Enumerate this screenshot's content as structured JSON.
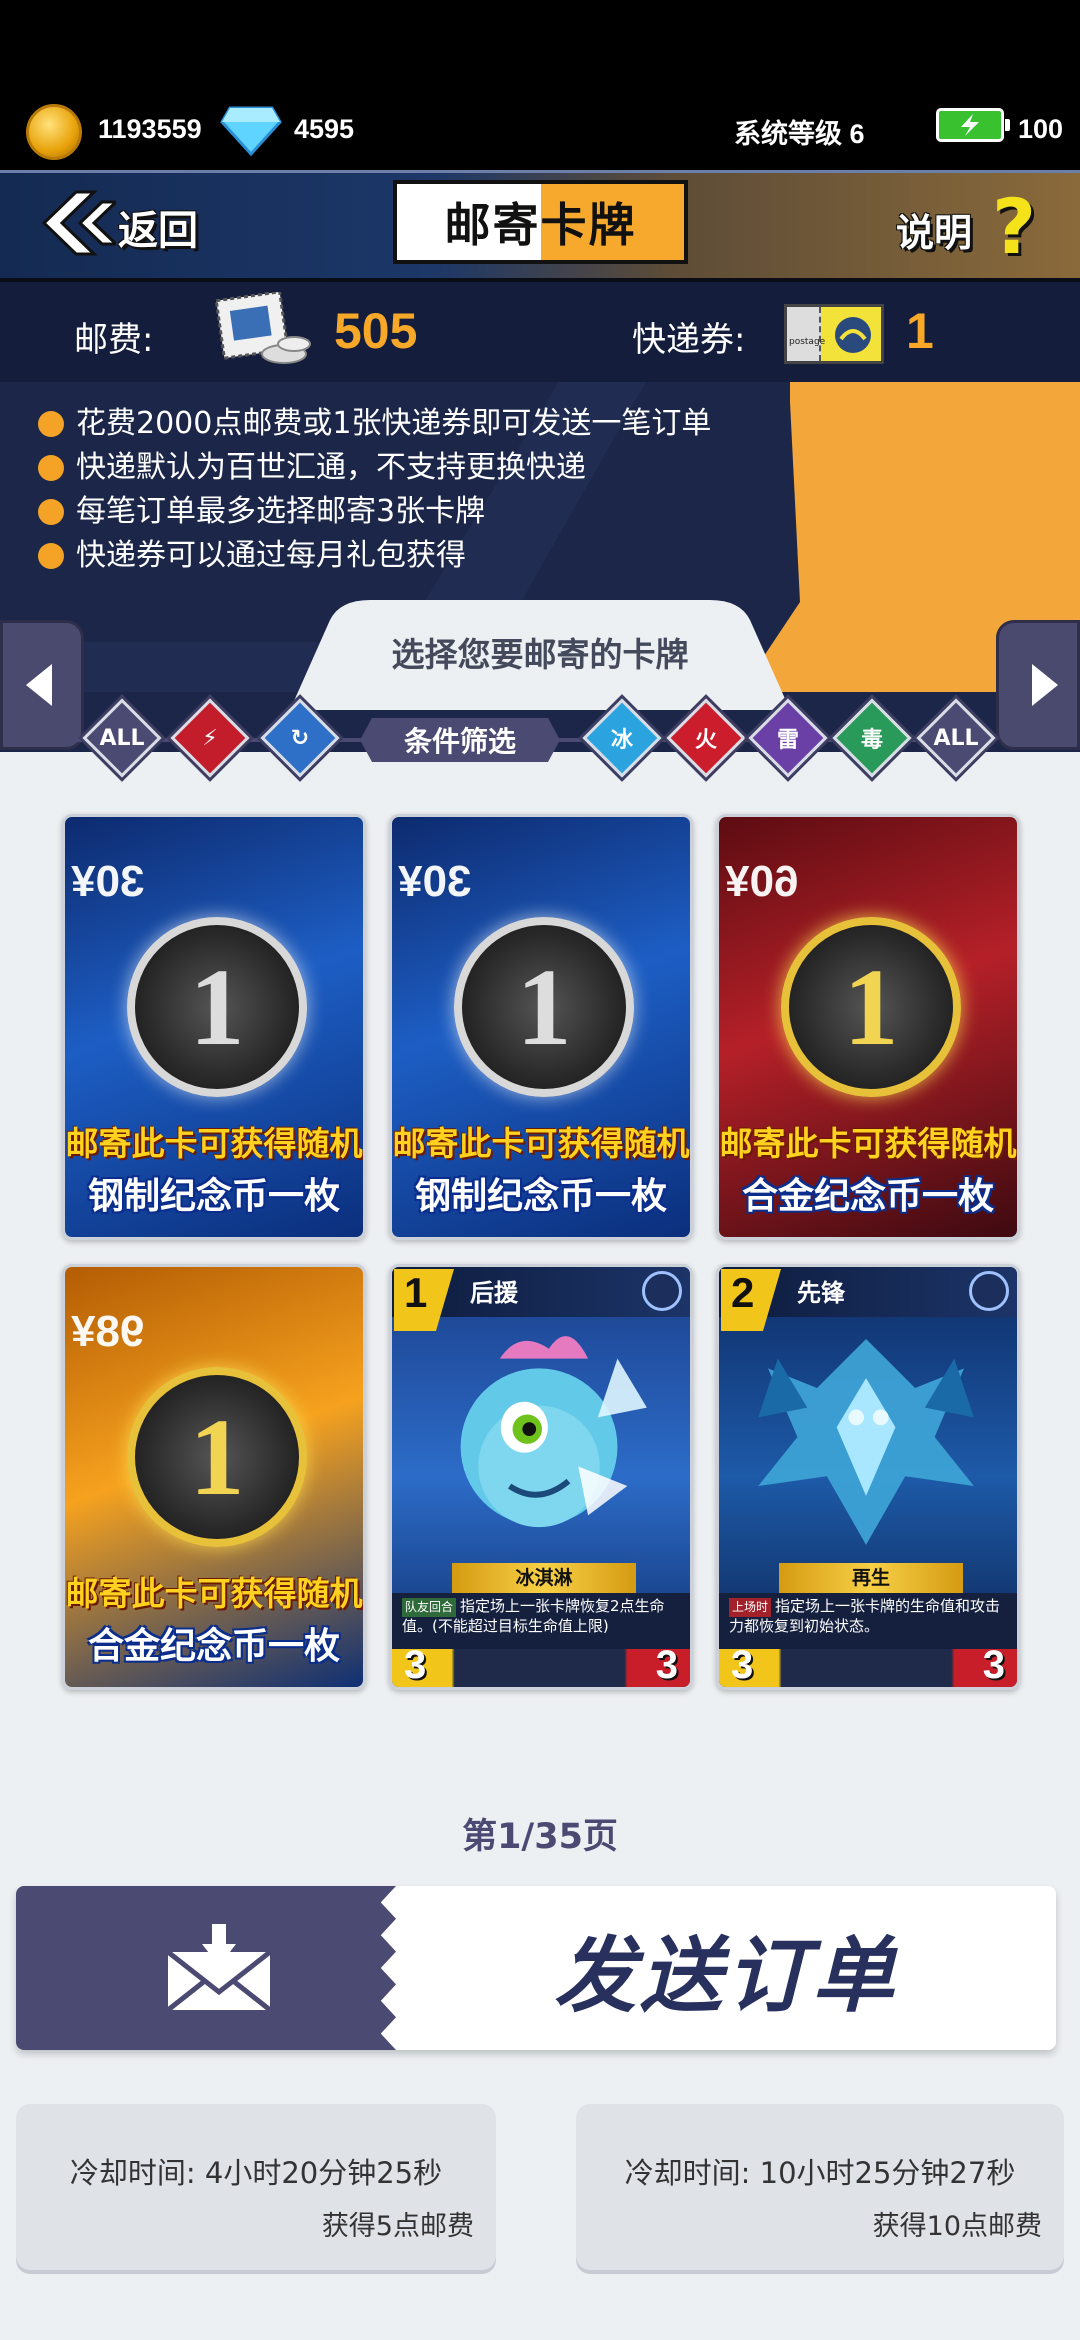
{
  "status_bar": {
    "gold": "1193559",
    "diamond": "4595",
    "system_level": "系统等级 6",
    "energy": "100"
  },
  "header": {
    "back_label": "返回",
    "title_left": "邮寄",
    "title_right": "卡牌",
    "help_label": "说明"
  },
  "info": {
    "postage_label": "邮费:",
    "postage_value": "505",
    "voucher_label": "快递券:",
    "voucher_value": "1",
    "voucher_icon_text": "postage",
    "rules": [
      "花费2000点邮费或1张快递券即可发送一笔订单",
      "快递默认为百世汇通，不支持更换快递",
      "每笔订单最多选择邮寄3张卡牌",
      "快递券可以通过每月礼包获得"
    ]
  },
  "select": {
    "title": "选择您要邮寄的卡牌",
    "filter_label": "条件筛选",
    "filters_left": [
      "ALL",
      "",
      ""
    ],
    "filters_right": [
      "冰",
      "火",
      "雷",
      "毒",
      "ALL"
    ]
  },
  "cards": [
    {
      "kind": "pack",
      "price": "30¥",
      "line1": "邮寄此卡可获得随机",
      "line2": "钢制纪念币一枚"
    },
    {
      "kind": "pack",
      "price": "30¥",
      "line1": "邮寄此卡可获得随机",
      "line2": "钢制纪念币一枚"
    },
    {
      "kind": "pack",
      "price": "60¥",
      "line1": "邮寄此卡可获得随机",
      "line2": "合金纪念币一枚"
    },
    {
      "kind": "pack",
      "price": "98¥",
      "line1": "邮寄此卡可获得随机",
      "line2": "合金纪念币一枚"
    },
    {
      "kind": "monster",
      "cost": "1",
      "role": "后援",
      "name": "冰淇淋",
      "tag": "队友回合",
      "desc": "指定场上一张卡牌恢复2点生命值。(不能超过目标生命值上限)",
      "atk": "3",
      "hp": "3"
    },
    {
      "kind": "monster",
      "cost": "2",
      "role": "先锋",
      "name": "再生",
      "tag": "上场时",
      "desc": "指定场上一张卡牌的生命值和攻击力都恢复到初始状态。",
      "atk": "3",
      "hp": "3"
    }
  ],
  "pagination": {
    "text": "第1/35页"
  },
  "send": {
    "label": "发送订单"
  },
  "cooldowns": [
    {
      "time": "冷却时间: 4小时20分钟25秒",
      "reward": "获得5点邮费"
    },
    {
      "time": "冷却时间: 10小时25分钟27秒",
      "reward": "获得10点邮费"
    }
  ],
  "colors": {
    "accent_orange": "#f7a829",
    "navy": "#1b2649",
    "purple": "#4b4a72",
    "battery_green": "#39c12f"
  }
}
